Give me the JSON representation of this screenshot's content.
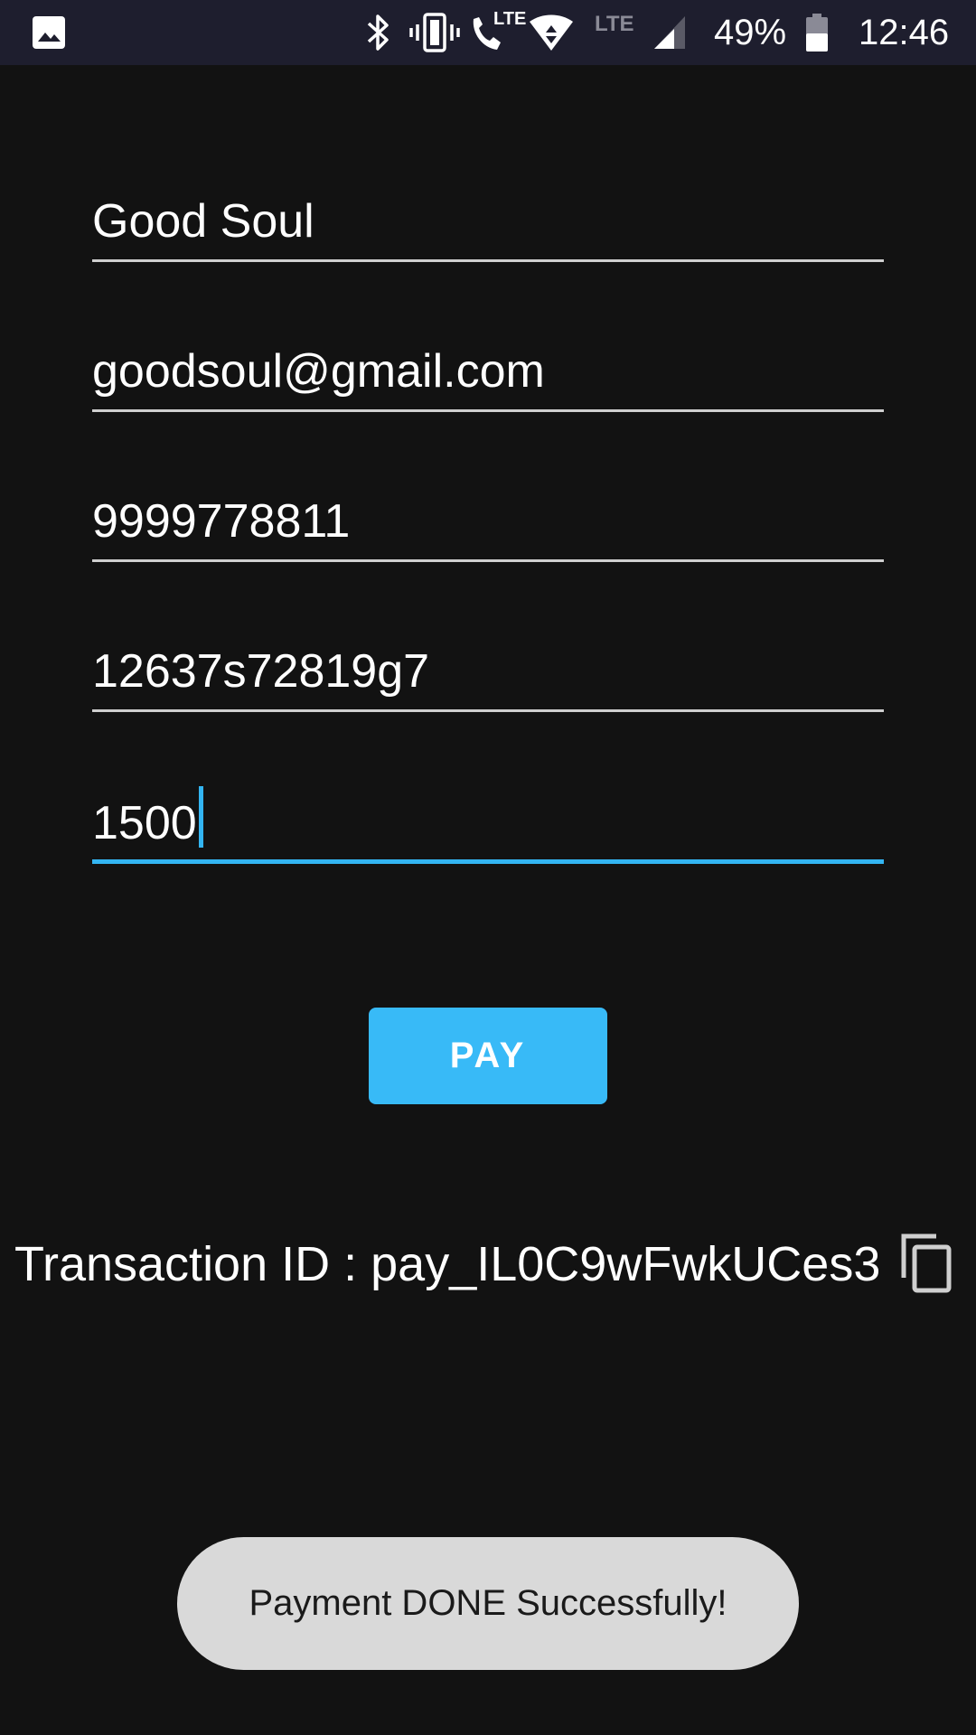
{
  "status_bar": {
    "battery_percent": "49%",
    "time": "12:46",
    "icons": [
      "gallery-icon",
      "bluetooth-icon",
      "vibrate-icon",
      "volte-call-icon",
      "wifi-icon",
      "lte-icon",
      "signal-icon",
      "battery-icon"
    ],
    "lte_call_label": "LTE",
    "lte_label": "LTE"
  },
  "form": {
    "name_value": "Good Soul",
    "email_value": "goodsoul@gmail.com",
    "phone_value": "9999778811",
    "id_value": "12637s72819g7",
    "amount_value": "1500"
  },
  "pay_button": {
    "label": "PAY"
  },
  "transaction": {
    "text": "Transaction ID : pay_IL0C9wFwkUCes3",
    "copy_icon": "copy-icon"
  },
  "toast": {
    "message": "Payment DONE Successfully!"
  },
  "colors": {
    "accent": "#38baf7",
    "background": "#121212",
    "status_bar": "#1e1e2e",
    "toast_bg": "#d9d9d9"
  }
}
